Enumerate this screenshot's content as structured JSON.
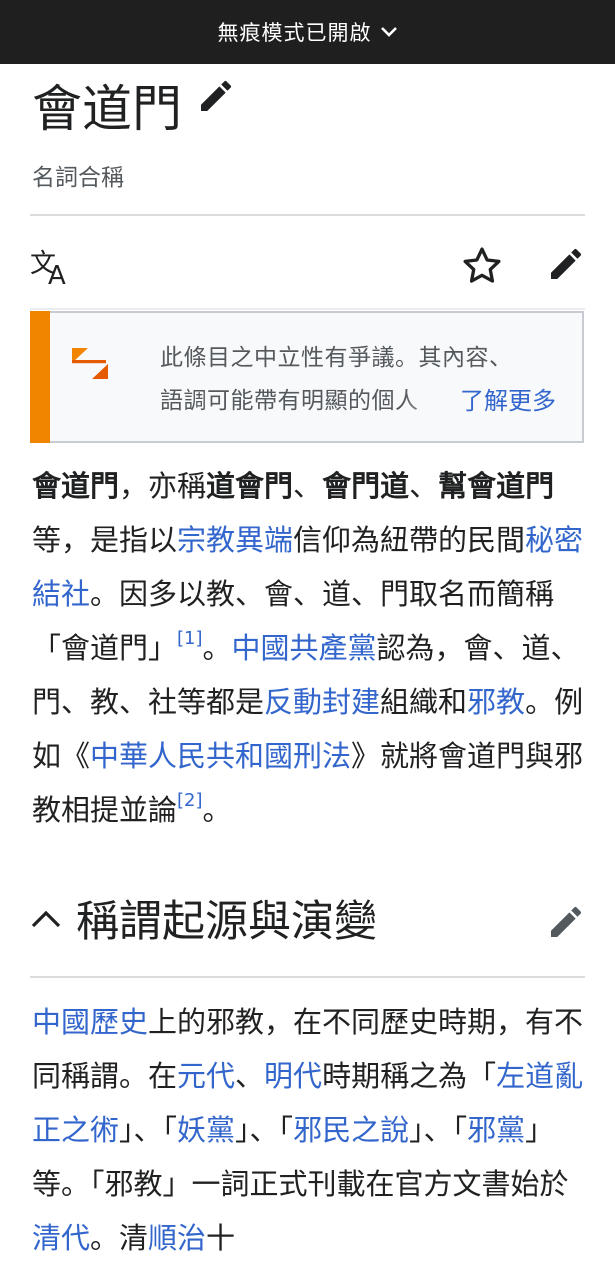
{
  "browser": {
    "incognito_label": "無痕模式已開啟"
  },
  "article": {
    "title": "會道門",
    "subtitle": "名詞合稱"
  },
  "notice": {
    "line1": "此條目之中立性有爭議。其內容、",
    "line2": "語調可能帶有明顯的個人",
    "more": "了解更多"
  },
  "lead": {
    "b1": "會道門",
    "t1": "，亦稱",
    "b2": "道會門",
    "t2": "、",
    "b3": "會門道",
    "t3": "、",
    "b4": "幫會道門",
    "t4": "等，是指以",
    "l1": "宗教異端",
    "t5": "信仰為紐帶的民間",
    "l2": "秘密結社",
    "t6": "。因多以教、會、道、門取名而簡稱「會道門」",
    "r1": "[1]",
    "t7": "。",
    "l3": "中國共產黨",
    "t8": "認為，會、道、門、教、社等都是",
    "l4": "反動封建",
    "t9": "組織和",
    "l5": "邪教",
    "t10": "。例如《",
    "l6": "中華人民共和國刑法",
    "t11": "》就將會道門與邪教相提並論",
    "r2": "[2]",
    "t12": "。"
  },
  "section": {
    "heading": "稱謂起源與演變"
  },
  "para2": {
    "l1": "中國歷史",
    "t1": "上的邪教，在不同歷史時期，有不同稱謂。在",
    "l2": "元代",
    "t2": "、",
    "l3": "明代",
    "t3": "時期稱之為「",
    "l4": "左道亂正之術",
    "t4": "」、「",
    "l5": "妖黨",
    "t5": "」、「",
    "l6": "邪民之說",
    "t6": "」、「",
    "l7": "邪黨",
    "t7": "」等。「邪教」一詞正式刊載在官方文書始於",
    "l8": "清代",
    "t8": "。清",
    "l9": "順治",
    "t9": "十"
  },
  "colors": {
    "link": "#3366cc",
    "notice_accent": "#f28500",
    "text": "#202122",
    "incognito_bar": "#1f1f1f"
  }
}
